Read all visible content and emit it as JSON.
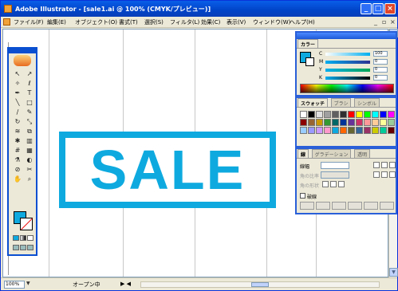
{
  "window": {
    "title": "Adobe Illustrator - [sale1.ai @ 100% (CMYK/プレビュー)]"
  },
  "menubar": {
    "items": [
      "ファイル(F)",
      "編集(E)",
      "オブジェクト(O)",
      "書式(T)",
      "選択(S)",
      "フィルタ(L)",
      "効果(C)",
      "表示(V)",
      "ウィンドウ(W)",
      "ヘルプ(H)"
    ]
  },
  "canvas": {
    "text": "SALE",
    "accent": "#0eaadf"
  },
  "statusbar": {
    "zoom": "100%",
    "status": "オープン中"
  },
  "color_panel": {
    "tab": "カラー",
    "labels": [
      "C",
      "M",
      "Y",
      "K"
    ],
    "values": [
      "100",
      "0",
      "0",
      "0"
    ]
  },
  "swatch_panel": {
    "tabs": [
      "スウォッチ",
      "ブラシ",
      "シンボル"
    ]
  },
  "stroke_panel": {
    "tabs": [
      "線",
      "グラデーション",
      "透明"
    ],
    "weight_label": "線幅",
    "miter_label": "角の比率",
    "join_label": "角の形状",
    "dash_label": "破線"
  }
}
